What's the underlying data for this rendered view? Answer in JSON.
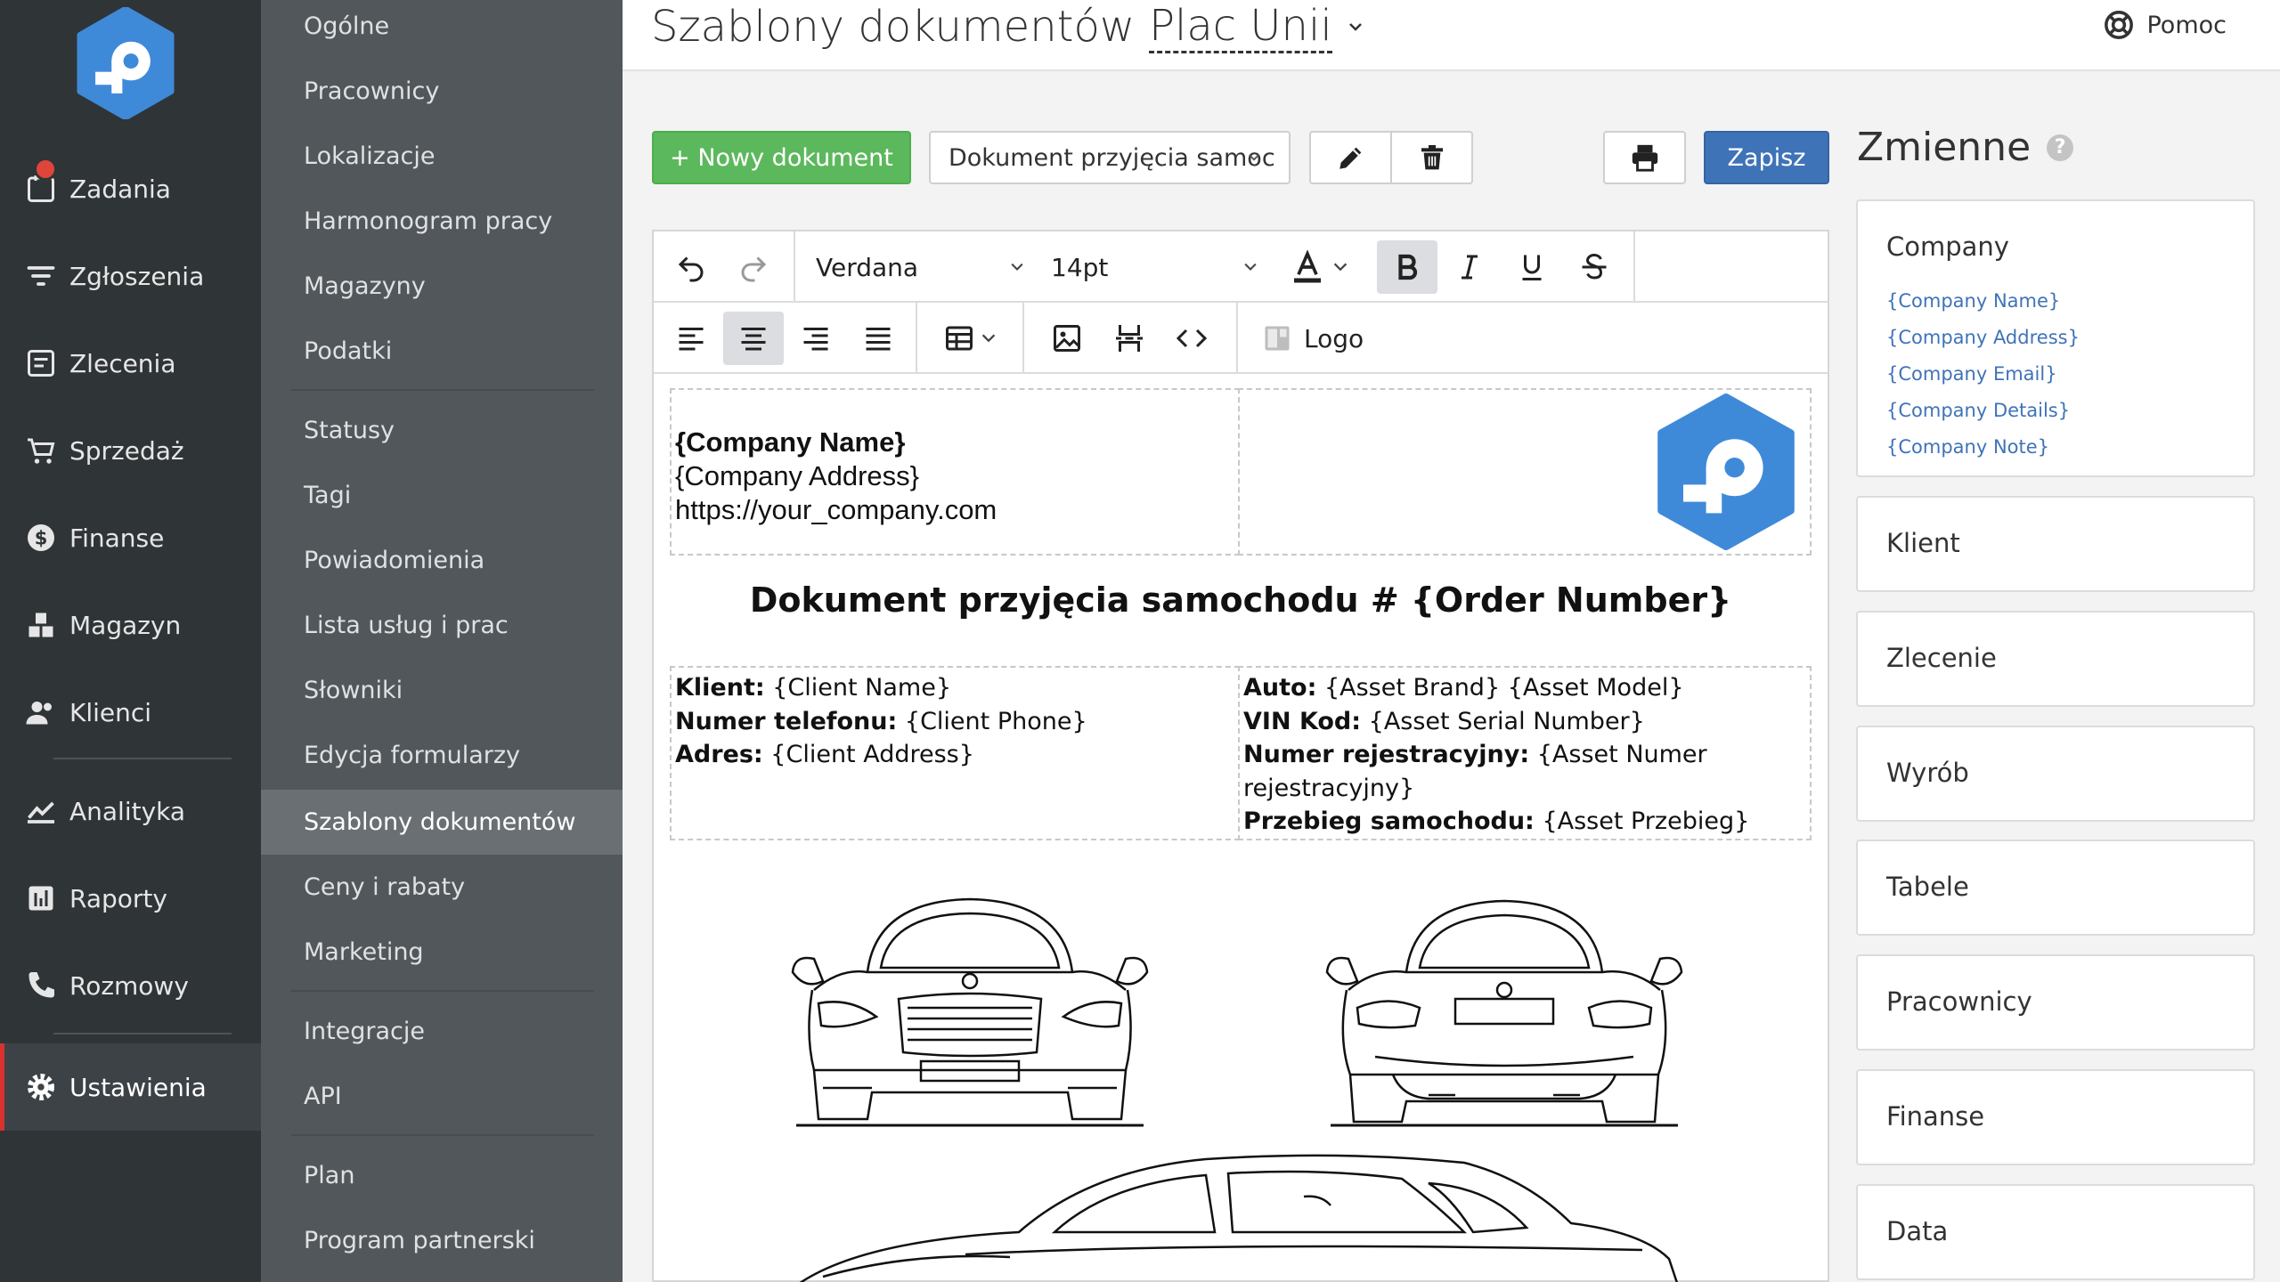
{
  "nav": {
    "items": [
      {
        "label": "Zadania"
      },
      {
        "label": "Zgłoszenia"
      },
      {
        "label": "Zlecenia"
      },
      {
        "label": "Sprzedaż"
      },
      {
        "label": "Finanse"
      },
      {
        "label": "Magazyn"
      },
      {
        "label": "Klienci"
      },
      {
        "label": "Analityka"
      },
      {
        "label": "Raporty"
      },
      {
        "label": "Rozmowy"
      },
      {
        "label": "Ustawienia"
      }
    ],
    "active": "Ustawienia"
  },
  "submenu": {
    "items": [
      {
        "label": "Ogólne"
      },
      {
        "label": "Pracownicy"
      },
      {
        "label": "Lokalizacje"
      },
      {
        "label": "Harmonogram pracy"
      },
      {
        "label": "Magazyny"
      },
      {
        "label": "Podatki"
      },
      {
        "label": "Statusy"
      },
      {
        "label": "Tagi"
      },
      {
        "label": "Powiadomienia"
      },
      {
        "label": "Lista usług i prac"
      },
      {
        "label": "Słowniki"
      },
      {
        "label": "Edycja formularzy"
      },
      {
        "label": "Szablony dokumentów"
      },
      {
        "label": "Ceny i rabaty"
      },
      {
        "label": "Marketing"
      },
      {
        "label": "Integracje"
      },
      {
        "label": "API"
      },
      {
        "label": "Plan"
      },
      {
        "label": "Program partnerski"
      }
    ],
    "active": "Szablony dokumentów"
  },
  "header": {
    "title": "Szablony dokumentów",
    "location": "Plac Unii",
    "help": "Pomoc"
  },
  "toolbar": {
    "new_label": "+ Nowy dokument",
    "selected_doc": "Dokument przyjęcia samoc",
    "save_label": "Zapisz"
  },
  "editor": {
    "font": "Verdana",
    "size": "14pt",
    "logo_label": "Logo"
  },
  "document": {
    "company_name": "{Company Name}",
    "company_address": "{Company Address}",
    "company_url": "https://your_company.com",
    "title": "Dokument przyjęcia samochodu # {Order Number}",
    "client": [
      {
        "k": "Klient:",
        "v": " {Client Name}"
      },
      {
        "k": "Numer telefonu:",
        "v": " {Client Phone}"
      },
      {
        "k": "Adres:",
        "v": " {Client Address}"
      }
    ],
    "asset": [
      {
        "k": "Auto:",
        "v": " {Asset Brand} {Asset Model}"
      },
      {
        "k": "VIN Kod:",
        "v": " {Asset Serial Number}"
      },
      {
        "k": "Numer rejestracyjny:",
        "v": " {Asset Numer rejestracyjny}"
      },
      {
        "k": "Przebieg samochodu:",
        "v": " {Asset Przebieg}"
      }
    ]
  },
  "variables": {
    "title": "Zmienne",
    "help_glyph": "?",
    "company": {
      "title": "Company",
      "links": [
        "{Company Name}",
        "{Company Address}",
        "{Company Email}",
        "{Company Details}",
        "{Company Note}"
      ]
    },
    "groups": [
      "Klient",
      "Zlecenie",
      "Wyrób",
      "Tabele",
      "Pracownicy",
      "Finanse",
      "Data"
    ]
  }
}
